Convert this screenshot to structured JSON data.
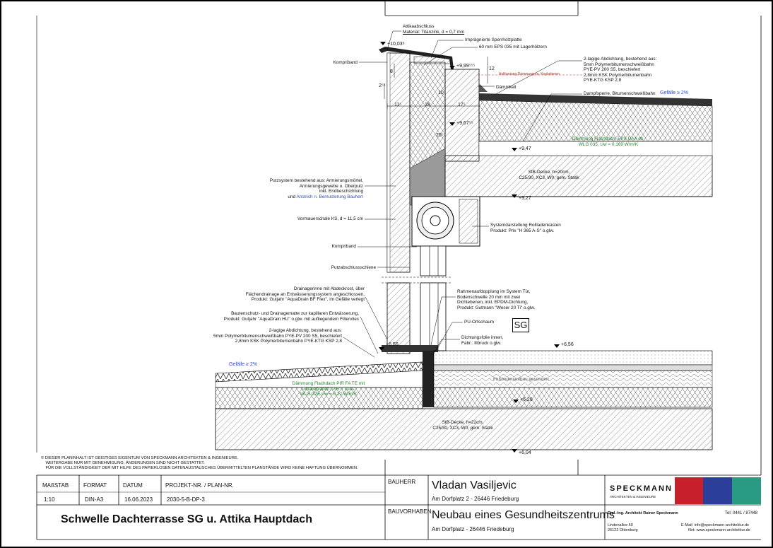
{
  "labels": {
    "attika": "Attikaabschluss",
    "attika_mat": "Material: Titanzink, d = 0,7 mm",
    "sperrholz": "Imprägnierte Sperrholzplatte",
    "eps": "60 mm EPS 035 mit Lagerhölzern",
    "abd_top": "2-lagige Abdichtung, bestehend aus:\n5mm Polymerbitumenschweißbahn\nPYE-PV 200 S5, beschiefert\n2,8mm KSK Polymerbitumenbahn\nPYE-KTG KSP 2,8",
    "aufkant": "Aufkantung Dämmung ca. Koplattieren",
    "daemmkeil": "Dämmkeil",
    "dampfsperre": "Dampfsperre, Bitumenschweißbahn",
    "gefaelle_top": "Gefälle ≥ 2%",
    "kompriband1": "Kompriband",
    "daemmung_flach": "Dämmung Flachdach, EPS DAA dh,\nWLG 035, Uw = 0,169 W/m²K",
    "stb_top": "StB-Decke, h=20cm,\nC25/30, XC3, W0, gem. Statik",
    "putzsystem": "Putzsystem bestehend aus: Armierungsmörtel,\nArmierungsgewebe u. Oberputz\ninkl. Endbeschichtung",
    "putzsystem_und": "und ",
    "putzsystem_blue": "Anstrich n. Bemusterung Bauherr",
    "vormauer": "Vormauerschale KS, d = 11,5 cm",
    "rolladen": "Systemdarstellung Rollladenkasten\nProdukt: Prix \"H 365 A-S\" o.glw.",
    "kompriband2": "Kompriband",
    "putzabschluss": "Putzabschlussschiene",
    "drainrinne": "Drainagerinne mit Abdeckrost, über\nFlächendrainage an Entwässerungssystem angeschlossen,\nProdukt: Gutjahr \"AquaDrain BF Flex\", im Gefälle verlegt",
    "bautenschutz": "Bautenschutz- und Drainagematte zur kapillaren Entwässerung,\nProdukt: Gutjahr \"AquaDrain HU\" o.glw. mit aufliegendem Filtervlies",
    "abd_low": "2-lagige Abdichtung, bestehend aus:\n5mm Polymerbitumenschweißbahn PYE-PV 200 S5, beschiefert\n2,8mm KSK Polymerbitumenbahn PYE-KTG KSP 2,8",
    "rahmen": "Rahmenaufdopplung im System Tür,\nBodenschwelle 20 mm mit zwei\nDichtebenen, inkl. EPDM-Dichtung,\nProdukt: Gutmann \"Weser 20 Ti\" o.glw.",
    "pu": "PU-Ortschaum",
    "dichtfolie": "Dichtungsfolie innen,\nFabr.: Illbruck o.glw.",
    "gefaelle_low": "Gefälle ≥ 2%",
    "daemm_pir": "Dämmung Flachdach PIR FA TE mit\nGefälleplatten, PIR T DAA,\nWLG 025, Uw = 0,22 W/m²K",
    "fussboden": "Fußbodenaufbau gesondert",
    "stb_low": "StB-Decke, h=22cm,\nC25/30, XC3, W0, gem. Statik",
    "sg": "SG"
  },
  "levels": {
    "l1": "+10,03⁸",
    "l2": "+9,99⁵⁵⁵",
    "l3": "+9,67⁵⁵",
    "l4": "+9,47",
    "l5": "+9,27",
    "l6": "+6,56",
    "l7": "+6,56",
    "l8": "+6,26",
    "l9": "+6,04"
  },
  "dims": {
    "d1": "11⁵",
    "d2": "18",
    "d3": "17⁵",
    "d4": "2⁵⁵",
    "d5": "8",
    "d6": "12",
    "d7": "20⁵",
    "d8": "10"
  },
  "copyright": "© DIESER PLANINHALT IST GEISTIGES EIGENTUM VON SPECKMANN ARCHITEKTEN & INGENIEURE.\n    WEITERGABE NUR MIT GENEHMIGUNG, ÄNDERUNGEN SIND NICHT GESTATTET.\n    FÜR DIE VOLLSTÄNDIGKEIT DER MIT HILFE DES PAPIERLOSEN DATENAUSTAUSCHES ÜBERMITTELTEN PLANSTÄNDE WIRD KEINE HAFTUNG ÜBERNOMMEN.",
  "titleblock": {
    "massstab_h": "MAßSTAB",
    "massstab": "1:10",
    "format_h": "FORMAT",
    "format": "DIN-A3",
    "datum_h": "DATUM",
    "datum": "16.06.2023",
    "projekt_h": "PROJEKT-NR. / PLAN-NR.",
    "projekt": "2030-5-B-DP-3",
    "plan_title": "Schwelle Dachterrasse SG u. Attika Hauptdach",
    "bauherr_h": "BAUHERR",
    "bauherr": "Vladan Vasiljevic",
    "bauherr_addr": "Am Dorfplatz 2 - 26446 Friedeburg",
    "bauvorhaben_h": "BAUVORHABEN",
    "bauvorhaben": "Neubau eines Gesundheitszentrums",
    "bauvorhaben_addr": "Am Dorfplatz  - 26446  Friedeburg",
    "firm": "SPECKMANN",
    "firm_sub": "ARCHITEKTEN & INGENIEURE",
    "architect": "Dipl.-Ing. Architekt Rainer Speckmann",
    "tel": "Tel: 0441 / 87448",
    "street": "Lindenallee 50",
    "city": "26122 Oldenburg",
    "email": "E-Mail: info@speckmann-architektur.de",
    "net": "Net: www.speckmann-architektur.de",
    "colors": [
      "#c8202a",
      "#2b3e99",
      "#2a9b83"
    ]
  }
}
